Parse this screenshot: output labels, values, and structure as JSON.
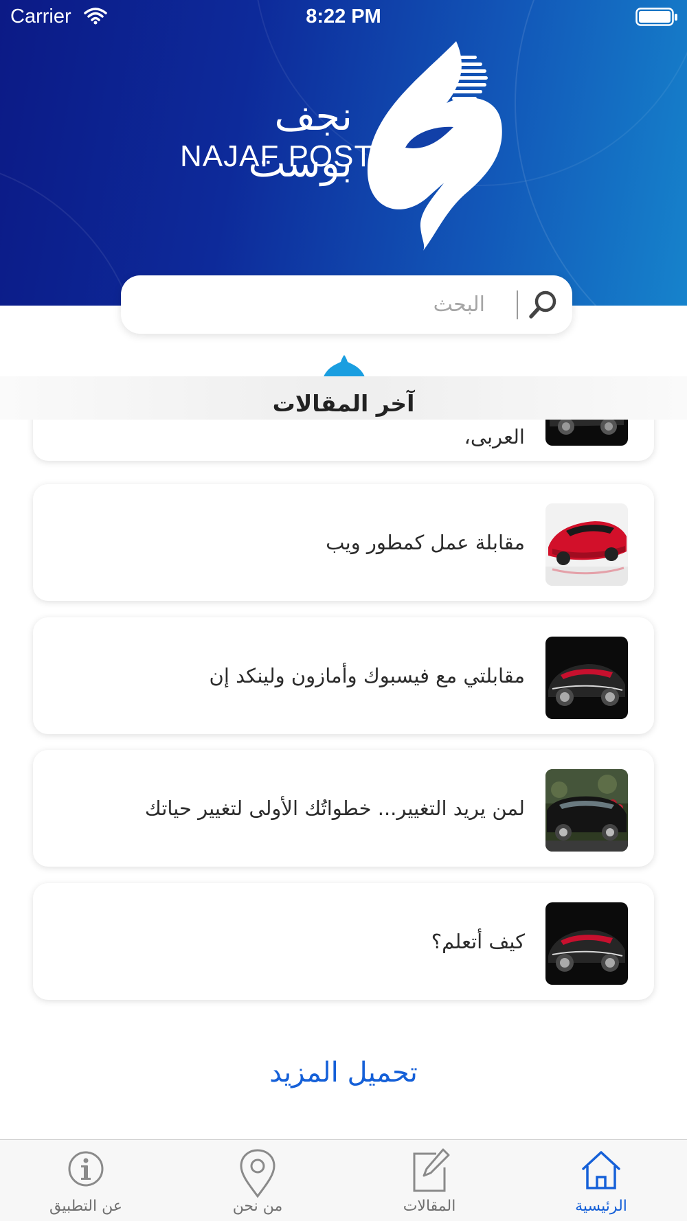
{
  "status_bar": {
    "carrier": "Carrier",
    "time": "8:22 PM"
  },
  "brand": {
    "name_ar": "نجف بوست",
    "name_en": "NAJAF POST"
  },
  "search": {
    "placeholder": "البحث",
    "value": ""
  },
  "section": {
    "title": "آخر المقالات"
  },
  "articles": [
    {
      "title": "العربى،",
      "thumbnail": "black-red-sports-car"
    },
    {
      "title": "مقابلة عمل كمطور ويب",
      "thumbnail": "red-sports-car"
    },
    {
      "title": "مقابلتي مع فيسبوك وأمازون ولينكد إن",
      "thumbnail": "black-red-sports-car"
    },
    {
      "title": "لمن يريد التغيير... خطواتُك الأولى لتغيير حياتك",
      "thumbnail": "black-sedan"
    },
    {
      "title": "كيف أتعلم؟",
      "thumbnail": "black-red-sports-car"
    }
  ],
  "load_more": "تحميل المزيد",
  "tabs": [
    {
      "label": "عن التطبيق",
      "icon": "info-icon",
      "active": false
    },
    {
      "label": "من نحن",
      "icon": "location-pin-icon",
      "active": false
    },
    {
      "label": "المقالات",
      "icon": "edit-icon",
      "active": false
    },
    {
      "label": "الرئيسية",
      "icon": "home-icon",
      "active": true
    }
  ],
  "colors": {
    "header_start": "#0c1a86",
    "header_end": "#1683cc",
    "accent": "#1560d8",
    "logo_accent": "#1aa7e0"
  }
}
